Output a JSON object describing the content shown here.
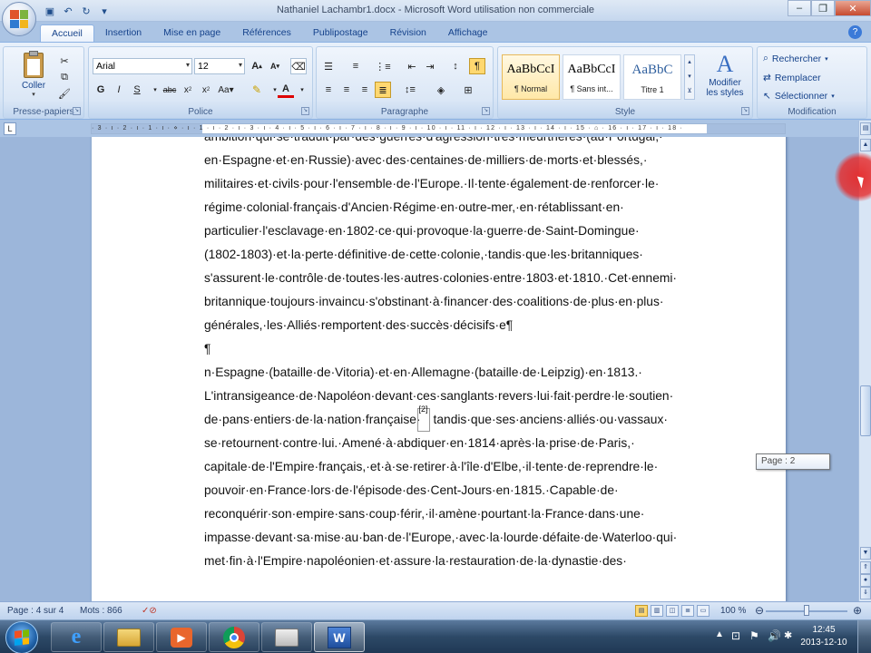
{
  "window": {
    "title": "Nathaniel Lachambr1.docx - Microsoft Word utilisation non commerciale"
  },
  "quick_access": [
    "save-icon",
    "undo-icon",
    "redo-icon",
    "customize-icon"
  ],
  "tabs": [
    {
      "label": "Accueil",
      "active": true
    },
    {
      "label": "Insertion"
    },
    {
      "label": "Mise en page"
    },
    {
      "label": "Références"
    },
    {
      "label": "Publipostage"
    },
    {
      "label": "Révision"
    },
    {
      "label": "Affichage"
    }
  ],
  "ribbon": {
    "clipboard": {
      "paste_label": "Coller",
      "group_label": "Presse-papiers"
    },
    "font": {
      "family": "Arial",
      "size": "12",
      "group_label": "Police"
    },
    "paragraph": {
      "group_label": "Paragraphe"
    },
    "styles": {
      "items": [
        {
          "sample": "AaBbCcI",
          "name": "¶ Normal"
        },
        {
          "sample": "AaBbCcI",
          "name": "¶ Sans int..."
        },
        {
          "sample": "AaBbC",
          "name": "Titre 1"
        }
      ],
      "modify_label_1": "Modifier",
      "modify_label_2": "les styles",
      "group_label": "Style"
    },
    "editing": {
      "find": "Rechercher",
      "replace": "Remplacer",
      "select": "Sélectionner",
      "group_label": "Modification"
    }
  },
  "ruler": {
    "ticks": "· 3 · ı · 2 · ı · 1 · ı · ⋄ · ı · 1 · ı · 2 · ı · 3 · ı · 4 · ı · 5 · ı · 6 · ı · 7 · ı · 8 · ı · 9 · ı · 10 · ı · 11 · ı · 12 · ı · 13 · ı · 14 · ı · 15 · ⌂ · 16 · ı · 17 · ı · 18 ·"
  },
  "document": {
    "lines": [
      "ambition·qui·se·traduit·par·des·guerres·d'agression·très·meurtrières·(au·Portugal,·",
      "en·Espagne·et·en·Russie)·avec·des·centaines·de·milliers·de·morts·et·blessés,·",
      "militaires·et·civils·pour·l'ensemble·de·l'Europe.·Il·tente·également·de·renforcer·le·",
      "régime·colonial·français·d'Ancien·Régime·en·outre-mer,·en·rétablissant·en·",
      "particulier·l'esclavage·en·1802·ce·qui·provoque·la·guerre·de·Saint-Domingue·",
      "(1802-1803)·et·la·perte·définitive·de·cette·colonie,·tandis·que·les·britanniques·",
      "s'assurent·le·contrôle·de·toutes·les·autres·colonies·entre·1803·et·1810.·Cet·ennemi·",
      "britannique·toujours·invaincu·s'obstinant·à·financer·des·coalitions·de·plus·en·plus·",
      "générales,·les·Alliés·remportent·des·succès·décisifs·e¶",
      "¶",
      "n·Espagne·(bataille·de·Vitoria)·et·en·Allemagne·(bataille·de·Leipzig)·en·1813.·",
      "L'intransigeance·de·Napoléon·devant·ces·sanglants·revers·lui·fait·perdre·le·soutien·",
      "de·pans·entiers·de·la·nation·française·",
      "tandis·que·ses·anciens·alliés·ou·vassaux·",
      "se·retournent·contre·lui.·Amené·à·abdiquer·en·1814·après·la·prise·de·Paris,·",
      "capitale·de·l'Empire·français,·et·à·se·retirer·à·l'île·d'Elbe,·il·tente·de·reprendre·le·",
      "pouvoir·en·France·lors·de·l'épisode·des·Cent-Jours·en·1815.·Capable·de·",
      "reconquérir·son·empire·sans·coup·férir,·il·amène·pourtant·la·France·dans·une·",
      "impasse·devant·sa·mise·au·ban·de·l'Europe,·avec·la·lourde·défaite·de·Waterloo·qui·",
      "met·fin·à·l'Empire·napoléonien·et·assure·la·restauration·de·la·dynastie·des·"
    ],
    "footnote_ref": "[2]"
  },
  "tooltip": {
    "page": "Page : 2"
  },
  "status": {
    "page": "Page : 4 sur 4",
    "words": "Mots : 866",
    "zoom": "100 %",
    "zoom_level": 0.5
  },
  "taskbar": {
    "apps": [
      "internet-explorer-icon",
      "file-explorer-icon",
      "media-player-icon",
      "chrome-icon",
      "folder-icon",
      "word-icon"
    ],
    "time": "12:45",
    "date": "2013-12-10"
  }
}
